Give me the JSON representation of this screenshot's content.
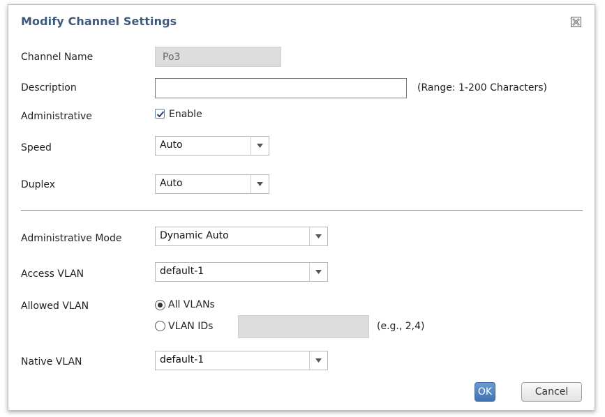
{
  "dialog": {
    "title": "Modify Channel Settings",
    "close_icon": "close-x-icon"
  },
  "fields": {
    "channel_name_label": "Channel Name",
    "channel_name_value": "Po3",
    "description_label": "Description",
    "description_value": "",
    "description_hint": "(Range: 1-200 Characters)",
    "administrative_label": "Administrative",
    "enable_label": "Enable",
    "enable_checked": true,
    "speed_label": "Speed",
    "speed_value": "Auto",
    "duplex_label": "Duplex",
    "duplex_value": "Auto",
    "admin_mode_label": "Administrative Mode",
    "admin_mode_value": "Dynamic Auto",
    "access_vlan_label": "Access VLAN",
    "access_vlan_value": "default-1",
    "allowed_vlan_label": "Allowed VLAN",
    "all_vlans_label": "All VLANs",
    "all_vlans_selected": true,
    "vlan_ids_label": "VLAN IDs",
    "vlan_ids_value": "",
    "vlan_ids_hint": "(e.g., 2,4)",
    "native_vlan_label": "Native VLAN",
    "native_vlan_value": "default-1"
  },
  "buttons": {
    "ok": "OK",
    "cancel": "Cancel"
  },
  "colors": {
    "title": "#3d5a7d",
    "ok_button": "#4a7dbd",
    "readonly_field": "#dddddd"
  }
}
